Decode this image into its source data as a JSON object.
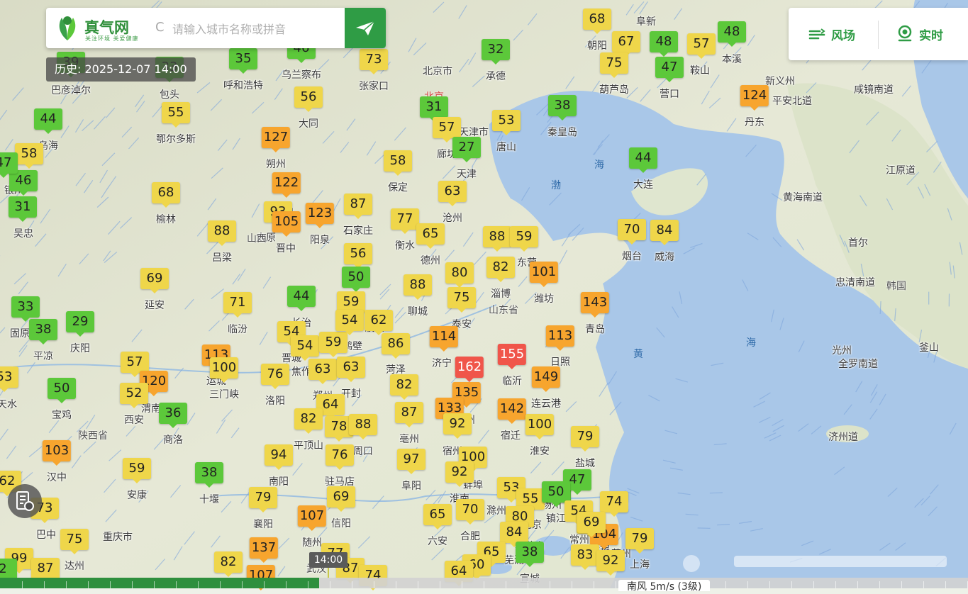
{
  "header": {
    "logo_name": "真气网",
    "logo_slogan": "关注环境 关爱健康",
    "search_prefix": "C",
    "search_placeholder": "请输入城市名称或拼音"
  },
  "history_badge": "历史: 2025-12-07 14:00",
  "controls": {
    "wind_label": "风场",
    "realtime_label": "实时"
  },
  "timeline": {
    "current_time": "14:00",
    "progress": 0.33,
    "wind_legend": "南风 5m/s (3级)"
  },
  "colors": {
    "good": "#5cc83a",
    "moderate": "#efd64a",
    "light": "#f7a52e",
    "medium": "#f0554a",
    "brand": "#2f9c45"
  },
  "map": {
    "capital_label": "北京",
    "sea_labels": [
      "渤",
      "海",
      "黄",
      "海"
    ],
    "region_labels": [
      "山西",
      "陕西省",
      "山东省",
      "韩国"
    ],
    "cities": [
      "巴彦淖尔",
      "包头",
      "呼和浩特",
      "乌兰察布",
      "张家口",
      "北京市",
      "承德",
      "朝阳",
      "葫芦岛",
      "营口",
      "鞍山",
      "本溪",
      "阜新",
      "丹东",
      "平安北道",
      "新义州",
      "咸镜南道",
      "鄂尔多斯",
      "大同",
      "唐山",
      "秦皇岛",
      "天津",
      "天津市",
      "廊坊",
      "保定",
      "石家庄",
      "沧州",
      "朔州",
      "忻州",
      "太原",
      "晋中",
      "阳泉",
      "吕梁",
      "榆林",
      "延安",
      "临汾",
      "长治",
      "衡水",
      "德州",
      "聊城",
      "济南",
      "淄博",
      "潍坊",
      "东营",
      "烟台",
      "威海",
      "大连",
      "青岛",
      "日照",
      "临沂",
      "济宁",
      "泰安",
      "菏泽",
      "濮阳",
      "鹤壁",
      "晋城",
      "焦作",
      "郑州",
      "开封",
      "商丘",
      "徐州",
      "连云港",
      "宿迁",
      "淮安",
      "盐城",
      "宿州",
      "蚌埠",
      "淮南",
      "合肥",
      "六安",
      "滁州",
      "南京",
      "扬州",
      "镇江",
      "常州",
      "无锡",
      "苏州",
      "上海",
      "南通",
      "阜阳",
      "亳州",
      "周口",
      "驻马店",
      "信阳",
      "平顶山",
      "洛阳",
      "三门峡",
      "运城",
      "西安",
      "渭南",
      "宝鸡",
      "平凉",
      "庆阳",
      "天水",
      "固原",
      "吴忠",
      "银川",
      "商洛",
      "汉中",
      "安康",
      "十堰",
      "南阳",
      "襄阳",
      "随州",
      "孝感",
      "武汉",
      "黄冈",
      "巴中",
      "达州",
      "重庆市",
      "乌海",
      "黄海南道",
      "江原道",
      "忠清南道",
      "全罗南道",
      "光州",
      "釜山",
      "济州道",
      "首尔",
      "宣城",
      "芜湖",
      "马鞍山"
    ],
    "aqi": [
      {
        "name": "巴彦淖尔",
        "v": 39
      },
      {
        "name": "包头",
        "v": 33
      },
      {
        "name": "呼和浩特",
        "v": 35
      },
      {
        "name": "乌兰察布",
        "v": 46
      },
      {
        "name": "张家口",
        "v": 73
      },
      {
        "name": "承德",
        "v": 32
      },
      {
        "name": "朝阳",
        "v": 68
      },
      {
        "name": "阜新",
        "v": 67
      },
      {
        "name": "葫芦岛",
        "v": 75
      },
      {
        "name": "营口",
        "v": 48
      },
      {
        "name": "鞍山",
        "v": 47
      },
      {
        "name": "本溪",
        "v": 57
      },
      {
        "name": "沈阳",
        "v": 48
      },
      {
        "name": "丹东",
        "v": 124
      },
      {
        "name": "乌海",
        "v": 44
      },
      {
        "name": "鄂尔多斯",
        "v": 55
      },
      {
        "name": "大同",
        "v": 56
      },
      {
        "name": "北京",
        "v": 31
      },
      {
        "name": "廊坊",
        "v": 57
      },
      {
        "name": "天津",
        "v": 27
      },
      {
        "name": "唐山",
        "v": 53
      },
      {
        "name": "秦皇岛",
        "v": 38
      },
      {
        "name": "保定",
        "v": 58
      },
      {
        "name": "朔州",
        "v": 127
      },
      {
        "name": "忻州",
        "v": 122
      },
      {
        "name": "石家庄",
        "v": 87
      },
      {
        "name": "沧州",
        "v": 63
      },
      {
        "name": "大连",
        "v": 44
      },
      {
        "name": "阳泉",
        "v": 123
      },
      {
        "name": "太原",
        "v": 93
      },
      {
        "name": "晋中",
        "v": 105
      },
      {
        "name": "衡水",
        "v": 77
      },
      {
        "name": "德州",
        "v": 65
      },
      {
        "name": "滨州",
        "v": 88
      },
      {
        "name": "东营",
        "v": 59
      },
      {
        "name": "烟台",
        "v": 70
      },
      {
        "name": "威海",
        "v": 84
      },
      {
        "name": "吕梁",
        "v": 88
      },
      {
        "name": "榆林",
        "v": 68
      },
      {
        "name": "邢台",
        "v": 56
      },
      {
        "name": "邯郸",
        "v": 50
      },
      {
        "name": "聊城",
        "v": 88
      },
      {
        "name": "济南",
        "v": 80
      },
      {
        "name": "淄博",
        "v": 82
      },
      {
        "name": "潍坊",
        "v": 101
      },
      {
        "name": "泰安",
        "v": 75
      },
      {
        "name": "延安",
        "v": 69
      },
      {
        "name": "临汾",
        "v": 71
      },
      {
        "name": "长治",
        "v": 44
      },
      {
        "name": "安阳",
        "v": 59
      },
      {
        "name": "青岛",
        "v": 143
      },
      {
        "name": "固原",
        "v": 33
      },
      {
        "name": "平凉",
        "v": 38
      },
      {
        "name": "庆阳",
        "v": 29
      },
      {
        "name": "晋城",
        "v": 54
      },
      {
        "name": "焦作",
        "v": 54
      },
      {
        "name": "新乡",
        "v": 59
      },
      {
        "name": "鹤壁",
        "v": 54
      },
      {
        "name": "濮阳",
        "v": 62
      },
      {
        "name": "菏泽",
        "v": 86
      },
      {
        "name": "济宁",
        "v": 114
      },
      {
        "name": "日照",
        "v": 113
      },
      {
        "name": "临沂",
        "v": 155
      },
      {
        "name": "枣庄",
        "v": 162
      },
      {
        "name": "连云港",
        "v": 149
      },
      {
        "name": "运城",
        "v": 113
      },
      {
        "name": "三门峡",
        "v": 100
      },
      {
        "name": "洛阳",
        "v": 76
      },
      {
        "name": "郑州",
        "v": 63
      },
      {
        "name": "开封",
        "v": 63
      },
      {
        "name": "商丘",
        "v": 82
      },
      {
        "name": "徐州",
        "v": 135
      },
      {
        "name": "铜川",
        "v": 57
      },
      {
        "name": "渭南",
        "v": 120
      },
      {
        "name": "咸阳",
        "v": 52
      },
      {
        "name": "宝鸡",
        "v": 50
      },
      {
        "name": "天水",
        "v": 53
      },
      {
        "name": "商洛",
        "v": 36
      },
      {
        "name": "许昌",
        "v": 64
      },
      {
        "name": "平顶山",
        "v": 82
      },
      {
        "name": "漯河",
        "v": 78
      },
      {
        "name": "周口",
        "v": 88
      },
      {
        "name": "亳州",
        "v": 87
      },
      {
        "name": "淮北",
        "v": 133
      },
      {
        "name": "宿迁",
        "v": 142
      },
      {
        "name": "宿州",
        "v": 92
      },
      {
        "name": "淮安",
        "v": 100
      },
      {
        "name": "盐城",
        "v": 79
      },
      {
        "name": "汉中",
        "v": 103
      },
      {
        "name": "安康",
        "v": 59
      },
      {
        "name": "十堰",
        "v": 38
      },
      {
        "name": "南阳",
        "v": 94
      },
      {
        "name": "驻马店",
        "v": 76
      },
      {
        "name": "阜阳",
        "v": 97
      },
      {
        "name": "蚌埠",
        "v": 100
      },
      {
        "name": "淮南",
        "v": 92
      },
      {
        "name": "广元",
        "v": 62
      },
      {
        "name": "巴中",
        "v": 73
      },
      {
        "name": "襄阳",
        "v": 79
      },
      {
        "name": "信阳",
        "v": 69
      },
      {
        "name": "随州",
        "v": 107
      },
      {
        "name": "滁州",
        "v": 53
      },
      {
        "name": "南京",
        "v": 55
      },
      {
        "name": "扬州",
        "v": 50
      },
      {
        "name": "泰州",
        "v": 47
      },
      {
        "name": "镇江",
        "v": 50
      },
      {
        "name": "南通",
        "v": 74
      },
      {
        "name": "六安",
        "v": 65
      },
      {
        "name": "合肥",
        "v": 70
      },
      {
        "name": "马鞍山",
        "v": 80
      },
      {
        "name": "常州",
        "v": 54
      },
      {
        "name": "无锡",
        "v": 69
      },
      {
        "name": "苏州",
        "v": 104
      },
      {
        "name": "上海",
        "v": 79
      },
      {
        "name": "芜湖",
        "v": 84
      },
      {
        "name": "达州",
        "v": 75
      },
      {
        "name": "南充",
        "v": 99
      },
      {
        "name": "遂宁",
        "v": 87
      },
      {
        "name": "孝感",
        "v": 137
      },
      {
        "name": "武汉",
        "v": 77
      },
      {
        "name": "黄冈",
        "v": 87
      },
      {
        "name": "宣城",
        "v": 38
      },
      {
        "name": "铜陵",
        "v": 65
      },
      {
        "name": "安庆",
        "v": 60
      },
      {
        "name": "池州",
        "v": 64
      },
      {
        "name": "湖州",
        "v": 83
      },
      {
        "name": "嘉兴",
        "v": 92
      },
      {
        "name": "成都",
        "v": 82
      },
      {
        "name": "重庆",
        "v": 107
      },
      {
        "name": "资阳",
        "v": 2
      },
      {
        "name": "绵阳",
        "v": 74
      },
      {
        "name": "吴忠",
        "v": 31
      },
      {
        "name": "银川",
        "v": 46
      },
      {
        "name": "石嘴山",
        "v": 58
      },
      {
        "name": "中卫",
        "v": 47
      },
      {
        "name": "荆门",
        "v": 69
      }
    ]
  }
}
